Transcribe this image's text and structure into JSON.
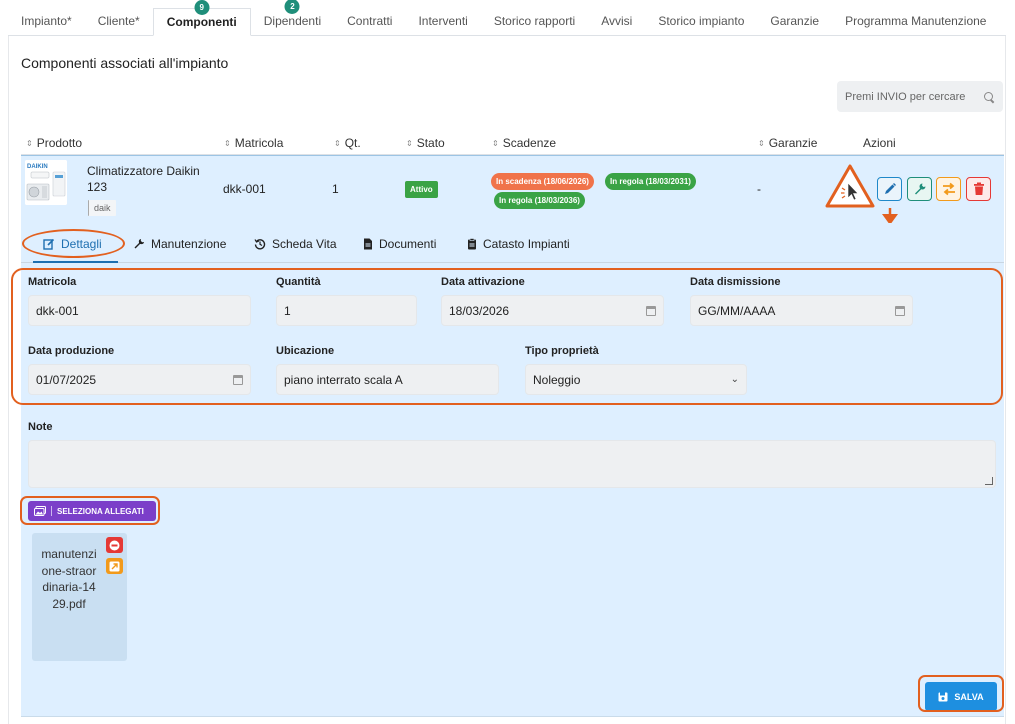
{
  "tabs": [
    {
      "label": "Impianto*",
      "badge": ""
    },
    {
      "label": "Cliente*",
      "badge": ""
    },
    {
      "label": "Componenti",
      "badge": "9"
    },
    {
      "label": "Dipendenti",
      "badge": "2"
    },
    {
      "label": "Contratti",
      "badge": ""
    },
    {
      "label": "Interventi",
      "badge": ""
    },
    {
      "label": "Storico rapporti",
      "badge": ""
    },
    {
      "label": "Avvisi",
      "badge": ""
    },
    {
      "label": "Storico impianto",
      "badge": ""
    },
    {
      "label": "Garanzie",
      "badge": ""
    },
    {
      "label": "Programma Manutenzione",
      "badge": ""
    }
  ],
  "page_title": "Componenti associati all'impianto",
  "search": {
    "placeholder": "Premi INVIO per cercare"
  },
  "table": {
    "headers": {
      "prodotto": "Prodotto",
      "matricola": "Matricola",
      "qt": "Qt.",
      "stato": "Stato",
      "scadenze": "Scadenze",
      "garanzie": "Garanzie",
      "azioni": "Azioni"
    },
    "row": {
      "brand_logo": "DAIKIN",
      "name": "Climatizzatore Daikin 123",
      "tag": "daik",
      "matricola": "dkk-001",
      "qt": "1",
      "stato": "Attivo",
      "scadenze": [
        {
          "label": "In scadenza (18/06/2026)",
          "color": "#f0734a"
        },
        {
          "label": "In regola (18/03/2031)",
          "color": "#3aa345"
        },
        {
          "label": "In regola (18/03/2036)",
          "color": "#3aa345"
        }
      ],
      "garanzie": "-"
    }
  },
  "detail": {
    "tabs": {
      "dettagli": "Dettagli",
      "manutenzione": "Manutenzione",
      "scheda_vita": "Scheda Vita",
      "documenti": "Documenti",
      "catasto": "Catasto Impianti"
    },
    "fields": {
      "matricola": {
        "label": "Matricola",
        "value": "dkk-001"
      },
      "quantita": {
        "label": "Quantità",
        "value": "1"
      },
      "data_attivazione": {
        "label": "Data attivazione",
        "value": "18/03/2026"
      },
      "data_dismissione": {
        "label": "Data dismissione",
        "value": "GG/MM/AAAA"
      },
      "data_produzione": {
        "label": "Data produzione",
        "value": "01/07/2025"
      },
      "ubicazione": {
        "label": "Ubicazione",
        "value": "piano interrato scala A"
      },
      "tipo_proprieta": {
        "label": "Tipo proprietà",
        "value": "Noleggio"
      }
    },
    "note": {
      "label": "Note",
      "value": ""
    },
    "upload_label": "SELEZIONA ALLEGATI",
    "attachment": {
      "name": "manutenzione-straordinaria-1429.pdf"
    },
    "save_label": "SALVA"
  },
  "colors": {
    "accent": "#1e8fe0",
    "highlight": "#e2601f",
    "purple": "#7b3fc9",
    "row_bg": "#deefff"
  }
}
